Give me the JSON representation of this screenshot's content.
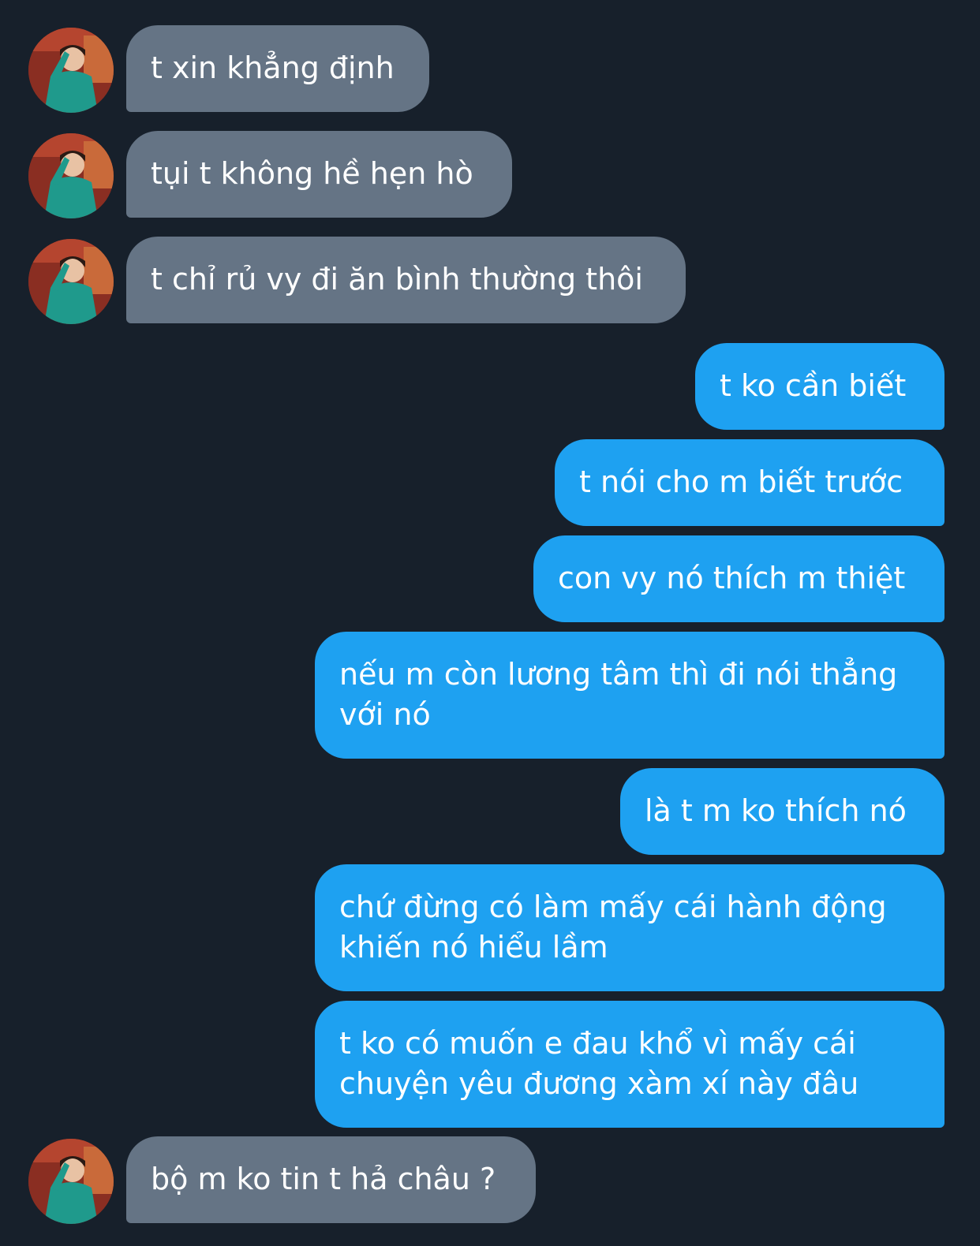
{
  "conversation": {
    "messages": [
      {
        "sender": "other",
        "text": "t xin khẳng định"
      },
      {
        "sender": "other",
        "text": "tụi t không hề hẹn hò"
      },
      {
        "sender": "other",
        "text": "t chỉ rủ vy đi ăn bình thường thôi"
      },
      {
        "sender": "me",
        "text": "t ko cần biết"
      },
      {
        "sender": "me",
        "text": "t nói cho m biết trước"
      },
      {
        "sender": "me",
        "text": "con vy nó thích m thiệt"
      },
      {
        "sender": "me",
        "text": "nếu m còn lương tâm thì đi nói thẳng\nvới nó"
      },
      {
        "sender": "me",
        "text": "là t m ko thích nó"
      },
      {
        "sender": "me",
        "text": "chứ đừng có làm mấy cái hành động\nkhiến nó hiểu lầm"
      },
      {
        "sender": "me",
        "text": "t ko có muốn e đau khổ vì mấy cái\nchuyện yêu đương xàm xí này đâu"
      },
      {
        "sender": "other",
        "text": "bộ m ko tin t hả châu ?"
      }
    ]
  },
  "colors": {
    "background": "#17202b",
    "incoming_bubble": "#657485",
    "outgoing_bubble": "#1ea1f1",
    "text": "#ffffff"
  },
  "icons": {
    "avatar": "profile-photo-avatar"
  }
}
